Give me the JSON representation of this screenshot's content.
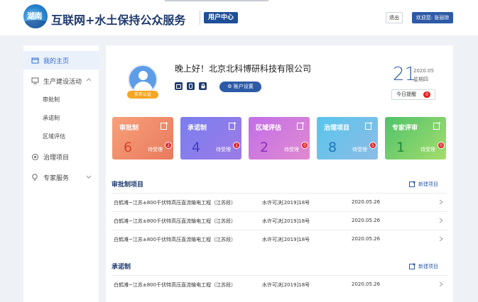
{
  "header": {
    "logo_text": "湖南",
    "site_title": "互联网+水土保持公众服务",
    "center_label": "用户中心",
    "logout_label": "退出",
    "welcome_label": "欢迎您: 张丽琼"
  },
  "sidebar": {
    "items": [
      {
        "label": "我的主页",
        "icon": "home-icon"
      },
      {
        "label": "生产建设活动",
        "icon": "monitor-icon"
      },
      {
        "label": "治理项目",
        "icon": "gear-icon"
      },
      {
        "label": "专家服务",
        "icon": "lightbulb-icon"
      }
    ],
    "sub_items": [
      "审批制",
      "承诺制",
      "区域评估"
    ]
  },
  "profile": {
    "greeting": "晚上好！北京北科博研科技有限公司",
    "auth_badge": "实名认证",
    "account_button": "账户设置",
    "date_day": "21",
    "date_year_month": "2020.05",
    "date_weekday": "星期四",
    "reminder_label": "今日提醒",
    "reminder_count": "0"
  },
  "cards": [
    {
      "title": "审批制",
      "count": "6",
      "pending_label": "待受理",
      "pending": "2",
      "color_start": "#f7a07a",
      "color_end": "#e97a5d",
      "num_color": "#d8452d"
    },
    {
      "title": "承诺制",
      "count": "4",
      "pending_label": "待受理",
      "pending": "1",
      "color_start": "#7a7ef0",
      "color_end": "#9d7be6",
      "num_color": "#3f3fc0"
    },
    {
      "title": "区域评估",
      "count": "2",
      "pending_label": "待受理",
      "pending": "0",
      "color_start": "#c26fe8",
      "color_end": "#e08ad0",
      "num_color": "#8a2fb8"
    },
    {
      "title": "治理项目",
      "count": "8",
      "pending_label": "待受理",
      "pending": "5",
      "color_start": "#58c6ec",
      "color_end": "#8dbbe6",
      "num_color": "#1a77b8"
    },
    {
      "title": "专家评审",
      "count": "1",
      "pending_label": "待受理",
      "pending": "0",
      "color_start": "#4fc36b",
      "color_end": "#a5dc6c",
      "num_color": "#1e8a3a"
    }
  ],
  "sections": [
    {
      "title": "审批制项目",
      "new_label": "新建项目",
      "rows": [
        {
          "name": "白鹤滩~江苏±800千伏特高压直流输电工程（江苏段）",
          "code": "水许可决[2019]18号",
          "date": "2020.05.26"
        },
        {
          "name": "白鹤滩~江苏±800千伏特高压直流输电工程（江苏段）",
          "code": "水许可决[2019]18号",
          "date": "2020.05.26"
        },
        {
          "name": "白鹤滩~江苏±800千伏特高压直流输电工程（江苏段）",
          "code": "水许可决[2019]18号",
          "date": "2020.05.26"
        }
      ]
    },
    {
      "title": "承诺制",
      "new_label": "新建项目",
      "rows": [
        {
          "name": "白鹤滩~江苏±800千伏特高压直流输电工程（江苏段）",
          "code": "水许可决[2019]18号",
          "date": "2020.05.26"
        }
      ]
    }
  ]
}
